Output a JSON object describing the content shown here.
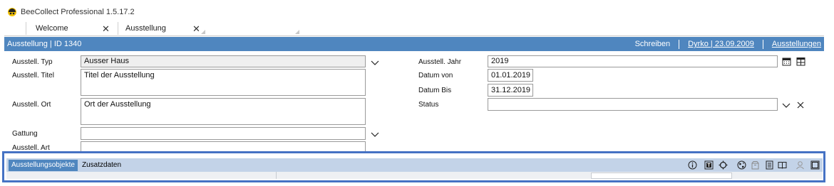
{
  "window": {
    "title": "BeeCollect Professional 1.5.17.2"
  },
  "tabs": [
    {
      "label": "Welcome"
    },
    {
      "label": "Ausstellung"
    }
  ],
  "header": {
    "title": "Ausstellung | ID 1340",
    "actions": {
      "schreiben": "Schreiben",
      "user_date": "Dyrko | 23.09.2009",
      "ausstellungen": "Ausstellungen"
    }
  },
  "form": {
    "typ": {
      "label": "Ausstell. Typ",
      "value": "Ausser Haus"
    },
    "titel": {
      "label": "Ausstell. Titel",
      "value": "Titel der Ausstellung"
    },
    "ort": {
      "label": "Ausstell. Ort",
      "value": "Ort der Ausstellung"
    },
    "gattung": {
      "label": "Gattung",
      "value": ""
    },
    "art": {
      "label": "Ausstell. Art",
      "value": ""
    },
    "jahr": {
      "label": "Ausstell. Jahr",
      "value": "2019"
    },
    "datum_von": {
      "label": "Datum von",
      "value": "01.01.2019"
    },
    "datum_bis": {
      "label": "Datum Bis",
      "value": "31.12.2019"
    },
    "status": {
      "label": "Status",
      "value": ""
    }
  },
  "bottom_tabs": [
    {
      "label": "Ausstellungsobjekte",
      "active": true
    },
    {
      "label": "Zusatzdaten",
      "active": false
    }
  ],
  "toolbar_icons": [
    "info-icon",
    "text-box-icon",
    "target-icon",
    "globe-icon",
    "box-icon",
    "document-icon",
    "book-icon",
    "person-icon",
    "panel-icon"
  ],
  "colors": {
    "header_bg": "#4f86bf",
    "toolbar_bg": "#c3d3e8",
    "highlight_frame": "#4572c4"
  }
}
